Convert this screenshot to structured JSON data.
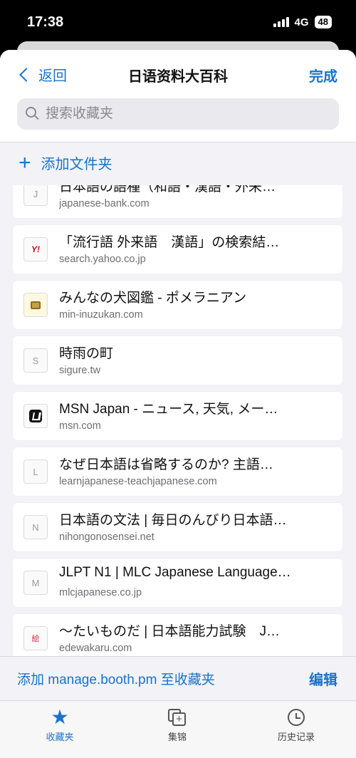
{
  "status_bar": {
    "time": "17:38",
    "network": "4G",
    "battery": "48"
  },
  "header": {
    "back_label": "返回",
    "title": "日语资料大百科",
    "done_label": "完成"
  },
  "search": {
    "placeholder": "搜索收藏夹"
  },
  "add_folder_label": "添加文件夹",
  "items": [
    {
      "favicon": "J",
      "title": "日本語の語種（和語・漢語・外来…",
      "url": "japanese-bank.com"
    },
    {
      "favicon": "Y!",
      "title": "「流行語 外来語　漢語」の検索結…",
      "url": "search.yahoo.co.jp"
    },
    {
      "favicon": "dog-icon",
      "title": "みんなの犬図鑑 - ポメラニアン",
      "url": "min-inuzukan.com"
    },
    {
      "favicon": "S",
      "title": "時雨の町",
      "url": "sigure.tw"
    },
    {
      "favicon": "msn-icon",
      "title": "MSN Japan - ニュース, 天気, メー…",
      "url": "msn.com"
    },
    {
      "favicon": "L",
      "title": "なぜ日本語は省略するのか? 主語…",
      "url": "learnjapanese-teachjapanese.com"
    },
    {
      "favicon": "N",
      "title": "日本語の文法 | 毎日のんびり日本語…",
      "url": "nihongonosensei.net"
    },
    {
      "favicon": "M",
      "title": "JLPT N1 | MLC Japanese Language…",
      "url": "mlcjapanese.co.jp"
    },
    {
      "favicon": "絵",
      "title": "〜たいものだ | 日本語能力試験　J…",
      "url": "edewakaru.com"
    }
  ],
  "bottom_bar": {
    "add_label": "添加 manage.booth.pm 至收藏夹",
    "edit_label": "编辑"
  },
  "tabs": [
    {
      "label": "收藏夹",
      "icon": "star-icon",
      "active": true
    },
    {
      "label": "集锦",
      "icon": "collections-icon",
      "active": false
    },
    {
      "label": "历史记录",
      "icon": "history-icon",
      "active": false
    }
  ],
  "colors": {
    "accent": "#1a73c9",
    "background": "#f2f2f7"
  }
}
